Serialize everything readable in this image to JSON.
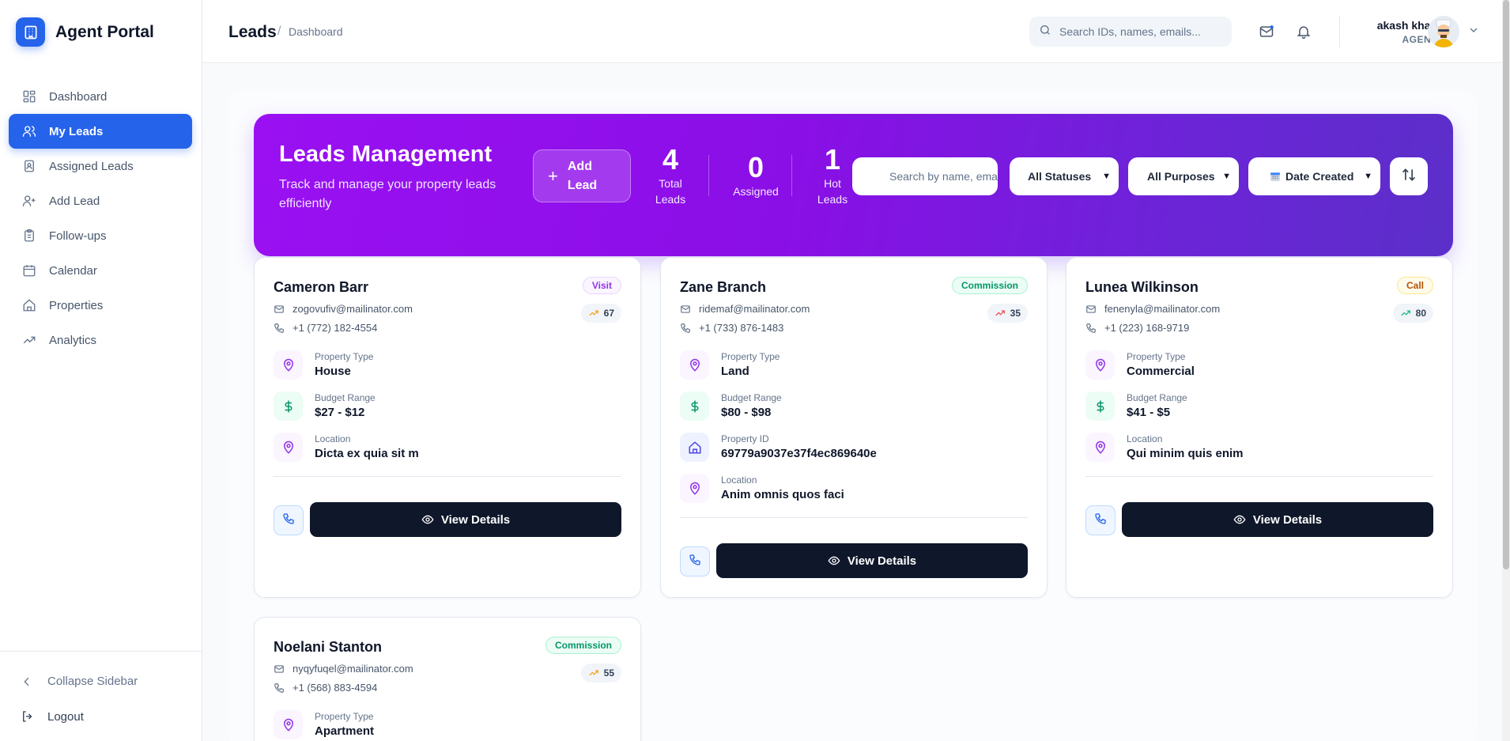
{
  "app": {
    "title": "Agent Portal"
  },
  "sidebar": {
    "items": [
      {
        "label": "Dashboard",
        "icon": "grid-icon"
      },
      {
        "label": "My Leads",
        "icon": "users-icon",
        "active": true
      },
      {
        "label": "Assigned Leads",
        "icon": "clipboard-user-icon"
      },
      {
        "label": "Add Lead",
        "icon": "user-plus-icon"
      },
      {
        "label": "Follow-ups",
        "icon": "clipboard-list-icon"
      },
      {
        "label": "Calendar",
        "icon": "calendar-icon"
      },
      {
        "label": "Properties",
        "icon": "home-icon"
      },
      {
        "label": "Analytics",
        "icon": "trending-up-icon"
      }
    ],
    "collapse_label": "Collapse Sidebar",
    "logout_label": "Logout"
  },
  "header": {
    "title": "Leads",
    "breadcrumb": "Dashboard",
    "search_placeholder": "Search IDs, names, emails...",
    "user": {
      "name": "akash khan",
      "role": "AGENT"
    }
  },
  "banner": {
    "title": "Leads Management",
    "subtitle": "Track and manage your property leads efficiently",
    "add_lead_label": "Add Lead",
    "stats": {
      "total": {
        "value": "4",
        "label": "Total Leads"
      },
      "assigned": {
        "value": "0",
        "label": "Assigned"
      },
      "hot": {
        "value": "1",
        "label": "Hot Leads"
      }
    },
    "search_placeholder": "Search by name, email...",
    "status_filter": "All Statuses",
    "purpose_filter": "All Purposes",
    "sort_field": "Date Created"
  },
  "cards": [
    {
      "name": "Cameron Barr",
      "badge": "Visit",
      "score": "67",
      "email": "zogovufiv@mailinator.com",
      "phone": "+1 (772) 182-4554",
      "property_type_label": "Property Type",
      "property_type": "House",
      "budget_label": "Budget Range",
      "budget": "$27 - $12",
      "location_label": "Location",
      "location": "Dicta ex quia sit m",
      "view_label": "View Details"
    },
    {
      "name": "Zane Branch",
      "badge": "Commission",
      "score": "35",
      "email": "ridemaf@mailinator.com",
      "phone": "+1 (733) 876-1483",
      "property_type_label": "Property Type",
      "property_type": "Land",
      "budget_label": "Budget Range",
      "budget": "$80 - $98",
      "property_id_label": "Property ID",
      "property_id": "69779a9037e37f4ec869640e",
      "location_label": "Location",
      "location": "Anim omnis quos faci",
      "view_label": "View Details"
    },
    {
      "name": "Lunea Wilkinson",
      "badge": "Call",
      "score": "80",
      "email": "fenenyla@mailinator.com",
      "phone": "+1 (223) 168-9719",
      "property_type_label": "Property Type",
      "property_type": "Commercial",
      "budget_label": "Budget Range",
      "budget": "$41 - $5",
      "location_label": "Location",
      "location": "Qui minim quis enim",
      "view_label": "View Details"
    },
    {
      "name": "Noelani Stanton",
      "badge": "Commission",
      "score": "55",
      "email": "nyqyfuqel@mailinator.com",
      "phone": "+1 (568) 883-4594",
      "property_type_label": "Property Type",
      "property_type": "Apartment"
    }
  ],
  "colors": {
    "accent": "#2563eb",
    "banner_start": "#9a10f2",
    "banner_end": "#5b2fc9",
    "button_dark": "#0f172a"
  }
}
